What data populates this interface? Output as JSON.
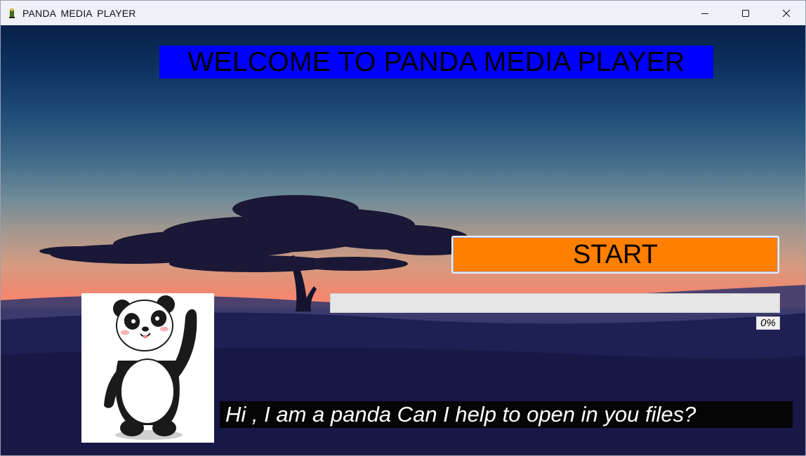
{
  "window": {
    "title": "PANDA  MEDIA  PLAYER",
    "app_icon": "panda-app-icon",
    "controls": {
      "minimize_icon": "minimize-icon",
      "maximize_icon": "maximize-icon",
      "close_icon": "close-icon"
    }
  },
  "main": {
    "welcome_text": "WELCOME TO PANDA MEDIA PLAYER",
    "start_label": "START",
    "progress": {
      "value": 0,
      "label": "0%"
    },
    "panda_image": "waving-panda-illustration",
    "caption": "Hi , I am a panda Can I help to open in you files?"
  },
  "colors": {
    "welcome_bg": "#0000ff",
    "start_bg": "#ff7f00",
    "caption_bg": "#050505",
    "caption_text": "#ffffff",
    "progress_track": "#e6e6e6"
  },
  "background_image": "sunset-tree-landscape"
}
